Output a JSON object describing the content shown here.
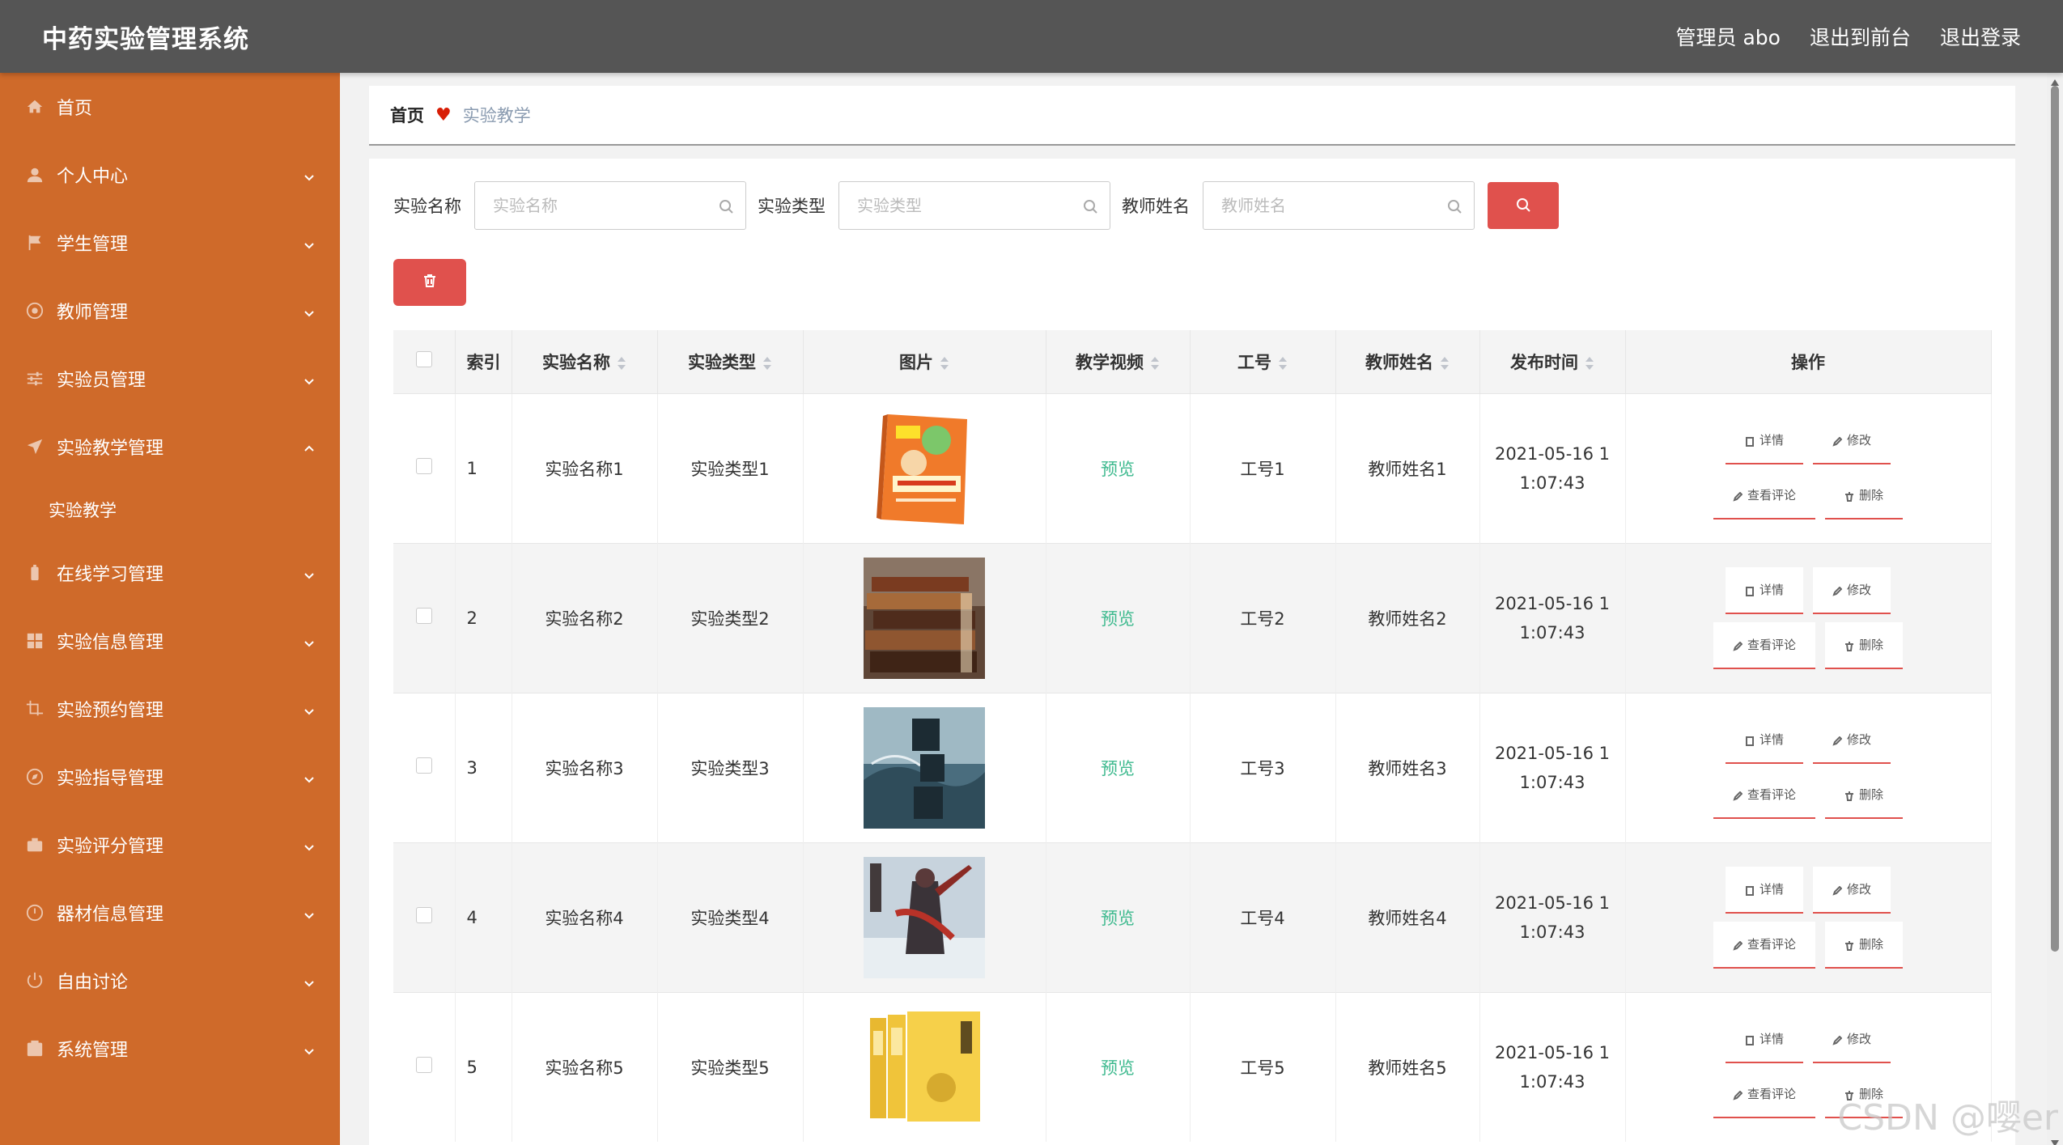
{
  "header": {
    "title": "中药实验管理系统",
    "actions": [
      "管理员 abo",
      "退出到前台",
      "退出登录"
    ]
  },
  "sidebar": {
    "items": [
      {
        "label": "首页",
        "icon": "home-icon",
        "has_arrow": false
      },
      {
        "label": "个人中心",
        "icon": "user-icon",
        "has_arrow": true
      },
      {
        "label": "学生管理",
        "icon": "flag-icon",
        "has_arrow": true
      },
      {
        "label": "教师管理",
        "icon": "globe-icon",
        "has_arrow": true
      },
      {
        "label": "实验员管理",
        "icon": "sliders-icon",
        "has_arrow": true
      },
      {
        "label": "实验教学管理",
        "icon": "paper-plane-icon",
        "has_arrow": true,
        "expanded": true,
        "children": [
          "实验教学"
        ]
      },
      {
        "label": "在线学习管理",
        "icon": "battery-icon",
        "has_arrow": true
      },
      {
        "label": "实验信息管理",
        "icon": "grid-icon",
        "has_arrow": true
      },
      {
        "label": "实验预约管理",
        "icon": "crop-icon",
        "has_arrow": true
      },
      {
        "label": "实验指导管理",
        "icon": "compass-icon",
        "has_arrow": true
      },
      {
        "label": "实验评分管理",
        "icon": "briefcase-icon",
        "has_arrow": true
      },
      {
        "label": "器材信息管理",
        "icon": "clock-icon",
        "has_arrow": true
      },
      {
        "label": "自由讨论",
        "icon": "power-icon",
        "has_arrow": true
      },
      {
        "label": "系统管理",
        "icon": "check-box-icon",
        "has_arrow": true
      }
    ]
  },
  "breadcrumb": {
    "home": "首页",
    "current": "实验教学"
  },
  "search": {
    "fields": [
      {
        "label": "实验名称",
        "placeholder": "实验名称"
      },
      {
        "label": "实验类型",
        "placeholder": "实验类型"
      },
      {
        "label": "教师姓名",
        "placeholder": "教师姓名"
      }
    ]
  },
  "table": {
    "columns": [
      "索引",
      "实验名称",
      "实验类型",
      "图片",
      "教学视频",
      "工号",
      "教师姓名",
      "发布时间",
      "操作"
    ],
    "rows": [
      {
        "index": "1",
        "name": "实验名称1",
        "type": "实验类型1",
        "video": "预览",
        "job_no": "工号1",
        "teacher": "教师姓名1",
        "time_line1": "2021-05-16 1",
        "time_line2": "1:07:43"
      },
      {
        "index": "2",
        "name": "实验名称2",
        "type": "实验类型2",
        "video": "预览",
        "job_no": "工号2",
        "teacher": "教师姓名2",
        "time_line1": "2021-05-16 1",
        "time_line2": "1:07:43"
      },
      {
        "index": "3",
        "name": "实验名称3",
        "type": "实验类型3",
        "video": "预览",
        "job_no": "工号3",
        "teacher": "教师姓名3",
        "time_line1": "2021-05-16 1",
        "time_line2": "1:07:43"
      },
      {
        "index": "4",
        "name": "实验名称4",
        "type": "实验类型4",
        "video": "预览",
        "job_no": "工号4",
        "teacher": "教师姓名4",
        "time_line1": "2021-05-16 1",
        "time_line2": "1:07:43"
      },
      {
        "index": "5",
        "name": "实验名称5",
        "type": "实验类型5",
        "video": "预览",
        "job_no": "工号5",
        "teacher": "教师姓名5",
        "time_line1": "2021-05-16 1",
        "time_line2": "1:07:43"
      }
    ],
    "op_labels": {
      "detail": "详情",
      "edit": "修改",
      "comments": "查看评论",
      "delete": "删除"
    }
  },
  "watermark": "CSDN @嘤er",
  "colors": {
    "header": "#555555",
    "sidebar": "#cf6a2a",
    "danger": "#e0514d",
    "preview": "#3fba8f"
  }
}
